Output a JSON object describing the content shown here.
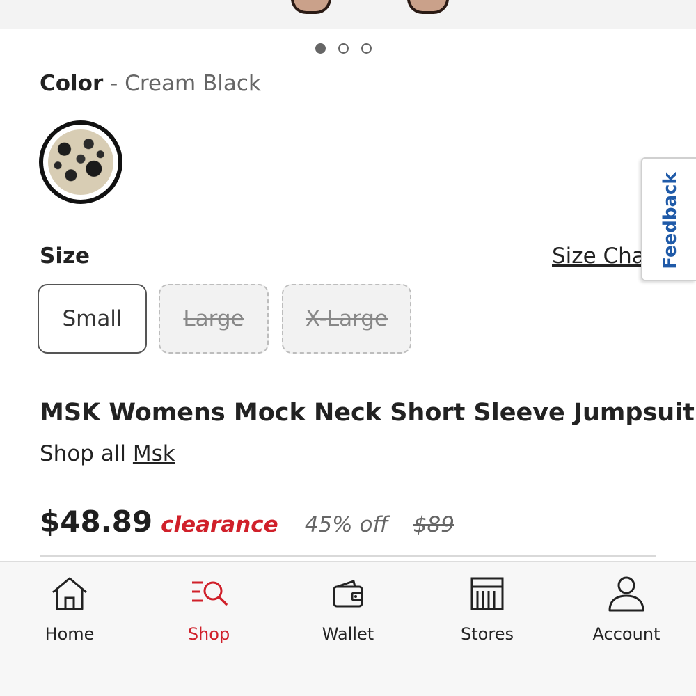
{
  "carousel": {
    "count": 3,
    "active_index": 0
  },
  "color": {
    "label": "Color",
    "separator": " - ",
    "selected": "Cream Black"
  },
  "size": {
    "label": "Size",
    "chart_link": "Size Chart",
    "options": [
      {
        "label": "Small",
        "available": true
      },
      {
        "label": "Large",
        "available": false
      },
      {
        "label": "X-Large",
        "available": false
      }
    ]
  },
  "feedback": {
    "label": "Feedback"
  },
  "product": {
    "title": "MSK Womens Mock Neck Short Sleeve Jumpsuit",
    "shop_all_prefix": "Shop all ",
    "brand": "Msk"
  },
  "price": {
    "sale": "$48.89",
    "tag": "clearance",
    "discount": "45% off",
    "original": "$89"
  },
  "colors": {
    "accent_red": "#d0202a",
    "feedback_blue": "#1f5aa8"
  },
  "nav": {
    "items": [
      {
        "label": "Home",
        "icon": "home-icon"
      },
      {
        "label": "Shop",
        "icon": "shop-icon",
        "active": true
      },
      {
        "label": "Wallet",
        "icon": "wallet-icon"
      },
      {
        "label": "Stores",
        "icon": "stores-icon"
      },
      {
        "label": "Account",
        "icon": "account-icon"
      }
    ]
  }
}
